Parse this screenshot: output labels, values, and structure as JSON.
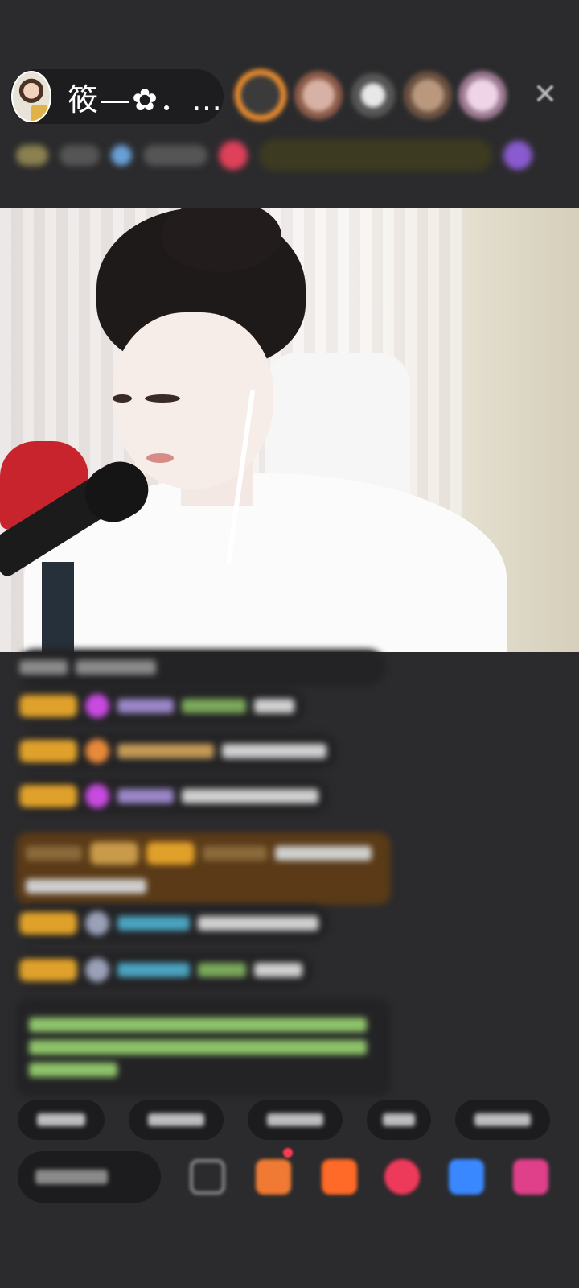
{
  "header": {
    "host_name": "筱—✿．…",
    "close_icon": "close-icon"
  },
  "colors": {
    "background": "#2b2b2d",
    "pill": "#1d1d1f",
    "level_badge": "#e0a12a",
    "system_text": "#8fc46a"
  }
}
